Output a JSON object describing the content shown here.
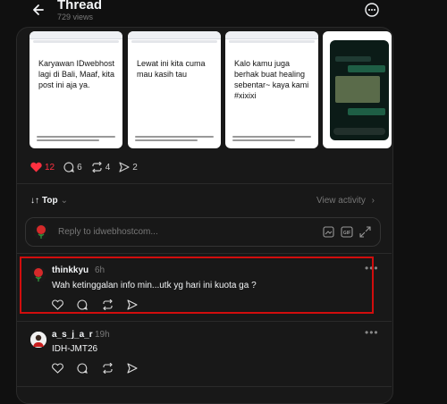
{
  "header": {
    "title": "Thread",
    "views": "729 views"
  },
  "media": [
    {
      "text": "Karyawan IDwebhost lagi di Bali, Maaf, kita post ini aja ya."
    },
    {
      "text": "Lewat ini kita cuma mau kasih tau"
    },
    {
      "text": "Kalo kamu juga berhak buat healing sebentar~ kaya kami #xixixi"
    }
  ],
  "post_actions": {
    "likes": "12",
    "comments": "6",
    "reposts": "4",
    "shares": "2"
  },
  "sort": {
    "label": "Top",
    "view_activity": "View activity"
  },
  "reply": {
    "placeholder": "Reply to idwebhostcom..."
  },
  "comments": [
    {
      "username": "thinkkyu",
      "time": "6h",
      "text": "Wah ketinggalan info min...utk yg hari ini kuota ga ?"
    },
    {
      "username": "a_s_j_a_r",
      "time": "19h",
      "text": "IDH-JMT26"
    }
  ],
  "colors": {
    "bg": "#101010",
    "like": "#ff3040",
    "highlight": "#d10d0d"
  }
}
